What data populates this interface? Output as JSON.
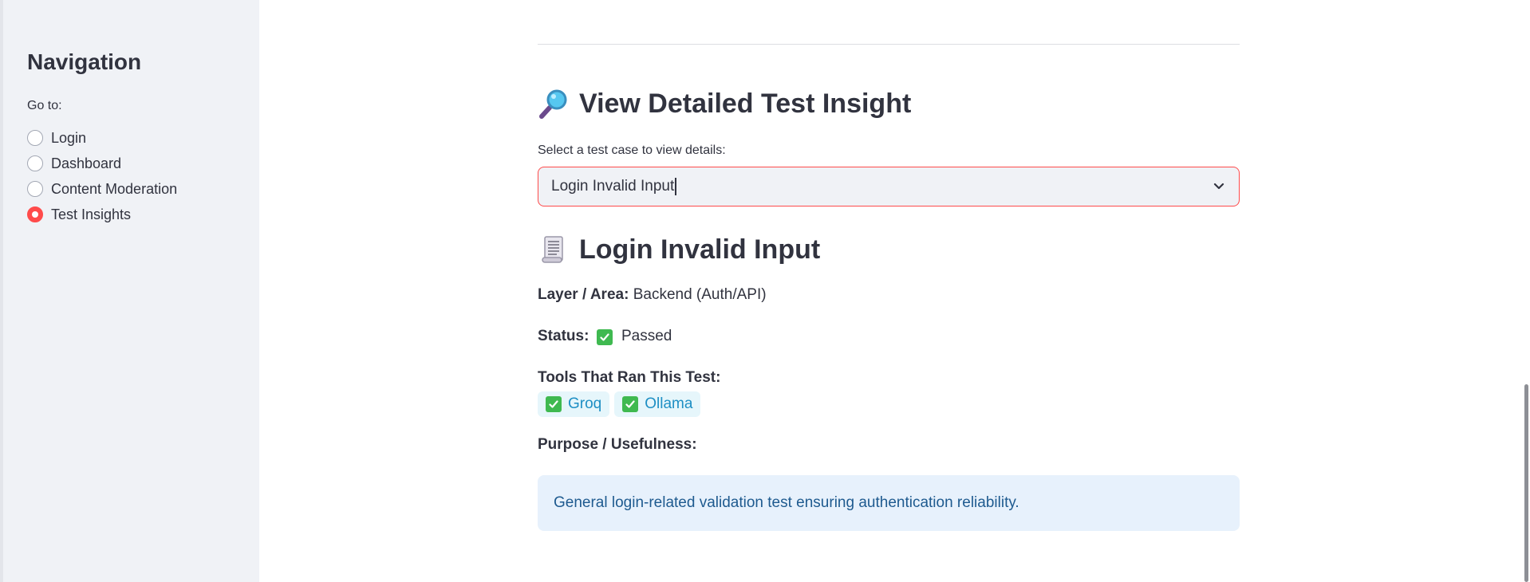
{
  "sidebar": {
    "title": "Navigation",
    "goto_label": "Go to:",
    "items": [
      {
        "label": "Login",
        "selected": false
      },
      {
        "label": "Dashboard",
        "selected": false
      },
      {
        "label": "Content Moderation",
        "selected": false
      },
      {
        "label": "Test Insights",
        "selected": true
      }
    ]
  },
  "main": {
    "section_title": "View Detailed Test Insight",
    "section_icon": "magnifying-glass-icon",
    "select": {
      "label": "Select a test case to view details:",
      "value": "Login Invalid Input"
    },
    "detail": {
      "title": "Login Invalid Input",
      "icon": "scroll-icon",
      "layer_label": "Layer / Area:",
      "layer_value": "Backend (Auth/API)",
      "status_label": "Status:",
      "status_value": "Passed",
      "tools_label": "Tools That Ran This Test:",
      "tools": [
        "Groq",
        "Ollama"
      ],
      "purpose_label": "Purpose / Usefulness:",
      "purpose_text": "General login-related validation test ensuring authentication reliability."
    }
  },
  "colors": {
    "accent": "#ff4b4b",
    "sidebar_bg": "#f0f2f6",
    "info_bg": "#e7f1fc",
    "info_text": "#1e5a8f",
    "chip_bg": "#e6f6fb",
    "chip_text": "#1e8fc4",
    "check_green": "#3fb950"
  }
}
